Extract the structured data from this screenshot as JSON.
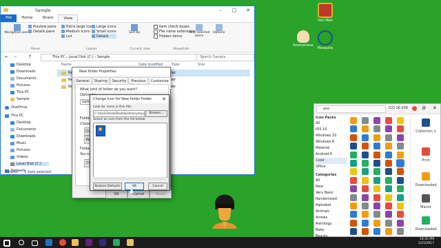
{
  "desktop": {
    "icons": [
      {
        "label": "Iron Man",
        "color": "#c0392b"
      },
      {
        "label": "Anonymous",
        "color": "#f5deb3"
      },
      {
        "label": "Mosquito",
        "color": "#1f4e8c"
      }
    ]
  },
  "explorer": {
    "title": "Sample",
    "ribbon_tabs": [
      "File",
      "Home",
      "Share",
      "View"
    ],
    "panes": {
      "nav_pane": "Navigation pane",
      "preview": "Preview pane",
      "details": "Details pane",
      "label": "Panes"
    },
    "layout": {
      "items": [
        "Extra large icons",
        "Large icons",
        "Medium icons",
        "Small icons",
        "List",
        "Details"
      ],
      "label": "Layout"
    },
    "current_view": {
      "sort": "Sort by",
      "label": "Current view"
    },
    "show_hide": {
      "items": [
        "Item check boxes",
        "File name extensions",
        "Hidden items"
      ],
      "hide_selected": "Hide selected items",
      "label": "Show/hide"
    },
    "options": "Options",
    "address": {
      "path": "This PC  ›  Local Disk (C:)  ›  Sample",
      "search_placeholder": "Search Sample"
    },
    "nav_items": [
      "Desktop",
      "Downloads",
      "Documents",
      "Pictures",
      "This PC",
      "Sample",
      "OneDrive",
      "This PC",
      "Desktop",
      "Documents",
      "Downloads",
      "Music",
      "Pictures",
      "Videos",
      "Local Disk (C:)",
      "Network"
    ],
    "columns": {
      "name": "Name",
      "date": "Date modified",
      "type": "Type",
      "size": "Size"
    },
    "rows": [
      {
        "name": "New",
        "type": "older"
      },
      {
        "name": "New",
        "type": "older"
      },
      {
        "name": "New",
        "type": "older"
      }
    ],
    "status": {
      "count": "3 items",
      "selected": "1 item selected"
    }
  },
  "properties": {
    "title": "New folder Properties",
    "tabs": [
      "General",
      "Sharing",
      "Security",
      "Previous Versions",
      "Customize"
    ],
    "question": "What kind of folder do you want?",
    "optimize": "Optimize",
    "general_value": "Gene",
    "folder_pictures": "Folder p",
    "choose": "Choose",
    "choose_btn": "Choo",
    "restore_btn": "Rest",
    "folder_icons": "Folder ic",
    "you_can": "You ca",
    "change_btn": "Cha",
    "ok": "OK",
    "cancel": "Cancel",
    "apply": "Apply"
  },
  "change_icon": {
    "title": "Change Icon for New folder Folder",
    "look_for": "Look for icons in this file:",
    "path": "C:\\Users\\horw\\Desktop\\Anonymous",
    "browse": "Browse...",
    "select_icon": "Select an icon from the list below:",
    "restore": "Restore Defaults",
    "ok": "OK",
    "cancel": "Cancel"
  },
  "icons8": {
    "search_value": "ano",
    "format": "ICO 16-256",
    "icon_packs_title": "Icon Packs",
    "packs": [
      "All",
      "iOS 10",
      "Windows 10",
      "Windows 8",
      "Material",
      "Android 4",
      "Color",
      "Office"
    ],
    "categories_title": "Categories",
    "categories": [
      "All",
      "New",
      "Very Basic",
      "Randomized",
      "Alphabet",
      "Animals",
      "Arrows",
      "Astrology",
      "Baby",
      "Beauty"
    ],
    "preview_labels": [
      "Collection 1",
      "Print",
      "Downloaded",
      "Matrix",
      "Downloaded"
    ]
  },
  "taskbar": {
    "time": "10:35 PM",
    "date": "1/15/2017"
  }
}
